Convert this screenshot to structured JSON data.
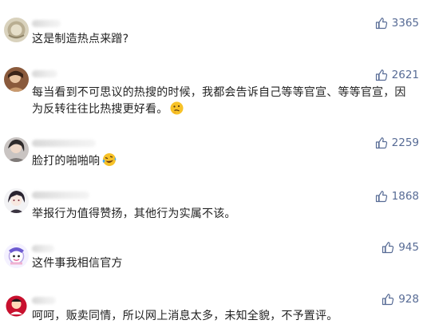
{
  "comments": [
    {
      "text": "这是制造热点来蹭?",
      "likes": "3365",
      "avatar": "avatar-beige-round",
      "emoji": null
    },
    {
      "text": "每当看到不可思议的热搜的时候，我都会告诉自己等等官宣、等等官宣，因为反转往往比热搜更好看。",
      "likes": "2621",
      "avatar": "avatar-person-photo",
      "emoji": "thinking-emoji"
    },
    {
      "text": "脸打的啪啪响",
      "likes": "2259",
      "avatar": "avatar-person-photo",
      "emoji": "laughing-crying-emoji"
    },
    {
      "text": "举报行为值得赞扬，其他行为实属不该。",
      "likes": "1868",
      "avatar": "avatar-anime-character",
      "emoji": null
    },
    {
      "text": "这件事我相信官方",
      "likes": "945",
      "avatar": "avatar-cartoon",
      "emoji": null
    },
    {
      "text": "呵呵，贩卖同情，所以网上消息太多，未知全貌，不予置评。",
      "likes": "928",
      "avatar": "avatar-red-cartoon",
      "emoji": null
    }
  ],
  "like_icon": "thumbs-up-icon",
  "accent_color": "#576b95"
}
